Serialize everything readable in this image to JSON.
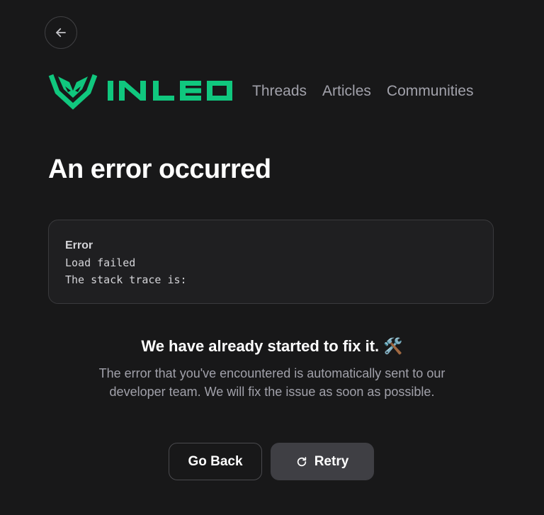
{
  "header": {
    "brand": "INLEO",
    "brand_color": "#10c77e",
    "nav": [
      {
        "label": "Threads"
      },
      {
        "label": "Articles"
      },
      {
        "label": "Communities"
      }
    ]
  },
  "main": {
    "title": "An error occurred",
    "error": {
      "label": "Error",
      "message": "Load failed",
      "stack_line": "The stack trace is:"
    },
    "fix_title": "We have already started to fix it. 🛠️",
    "fix_description": "The error that you've encountered is automatically sent to our developer team. We will fix the issue as soon as possible.",
    "buttons": {
      "go_back": "Go Back",
      "retry": "Retry"
    }
  },
  "icons": {
    "back": "arrow-left-icon",
    "retry": "rotate-cw-icon",
    "logo": "lion-logo-icon"
  }
}
